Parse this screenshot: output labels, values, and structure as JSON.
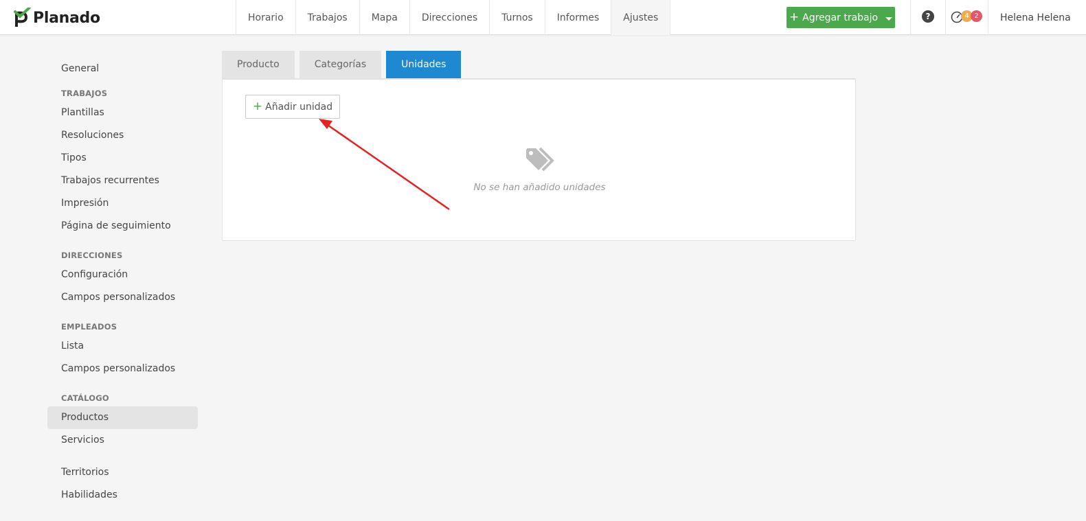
{
  "app": {
    "name": "Planado",
    "brand_color": "#4ca84c"
  },
  "nav": {
    "items": [
      "Horario",
      "Trabajos",
      "Mapa",
      "Direcciones",
      "Turnos",
      "Informes",
      "Ajustes"
    ],
    "active": "Ajustes"
  },
  "header": {
    "add_job_label": "Agregar trabajo",
    "help_label": "?",
    "badges": {
      "orange": "4",
      "red": "2"
    },
    "user_name": "Helena Helena"
  },
  "sidebar": {
    "general": "General",
    "trabajos_heading": "TRABAJOS",
    "plantillas": "Plantillas",
    "resoluciones": "Resoluciones",
    "tipos": "Tipos",
    "recurrentes": "Trabajos recurrentes",
    "impresion": "Impresión",
    "seguimiento": "Página de seguimiento",
    "direcciones_heading": "DIRECCIONES",
    "configuracion": "Configuración",
    "campos_dir": "Campos personalizados",
    "empleados_heading": "EMPLEADOS",
    "lista": "Lista",
    "campos_emp": "Campos personalizados",
    "catalogo_heading": "CATÁLOGO",
    "productos": "Productos",
    "servicios": "Servicios",
    "territorios": "Territorios",
    "habilidades": "Habilidades"
  },
  "tabs": {
    "producto": "Producto",
    "categorias": "Categorías",
    "unidades": "Unidades",
    "active": "Unidades"
  },
  "panel": {
    "add_unit_label": "Añadir unidad",
    "empty_text": "No se han añadido unidades",
    "empty_icon": "tags-icon"
  },
  "colors": {
    "tab_active": "#1e88d0",
    "arrow": "#e82020"
  }
}
